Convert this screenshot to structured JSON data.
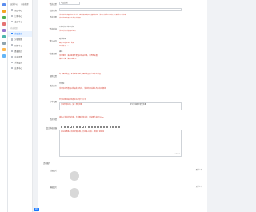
{
  "rail": {
    "colors": [
      "#5b8def",
      "#f5a623",
      "#4caf50",
      "#e57373",
      "#9575cd",
      "#4db6ac",
      "#90a4ae",
      "#ffb74d",
      "#64b5f6"
    ]
  },
  "sidebar": {
    "tabs": [
      "运营中心",
      "内容管理"
    ],
    "group": "内容管理",
    "items": [
      {
        "label": "商品中心",
        "icon": "box-icon",
        "active": false
      },
      {
        "label": "订单中心",
        "icon": "order-icon",
        "active": false
      },
      {
        "label": "会员中心",
        "icon": "user-icon",
        "active": false
      },
      {
        "label": "营销活动",
        "icon": "gift-icon",
        "active": true
      },
      {
        "label": "分销管理",
        "icon": "share-icon",
        "active": false
      },
      {
        "label": "财务中心",
        "icon": "wallet-icon",
        "active": false
      },
      {
        "label": "数据统计",
        "icon": "chart-icon",
        "active": false
      },
      {
        "label": "店铺设置",
        "icon": "shop-icon",
        "active": false
      },
      {
        "label": "系统设置",
        "icon": "gear-icon",
        "active": false
      },
      {
        "label": "应用中心",
        "icon": "app-icon",
        "active": false
      }
    ]
  },
  "form": {
    "type_label": "活动类型",
    "type_value": "单品活动",
    "name_label": "活动名称",
    "desc_label": "活动说明",
    "desc_hint1": "活动名称不超过20个字符，建议填写简短易懂的名称。活动开始前可修改，开始后不可修改",
    "desc_hint2": "活动说明将展示在商品详情页",
    "time_label": "活动时间",
    "time_value": "开始时间 - 结束时间",
    "time_hint": "活动时间不能超过30天",
    "goods_label": "参与商品",
    "goods_value": "选择商品",
    "goods_hint1": "最多可选择50个商品",
    "goods_hint2": "已选商品：0",
    "rule_label": "优惠规则",
    "rule_value": "满减",
    "rule_hint1": "活动规则：满减金额不能超过商品价格，请合理设置",
    "rule_hint2": "满减门槛：满X元减Y元",
    "limit_label": "限购设置",
    "limit_hint": "每人限购数量，不填则不限购；限购数量需小于库存数量",
    "stock_label": "活动库存",
    "stock_value": "不限制",
    "stock_hint": "活动库存不能超过商品实际库存，活动结束后剩余库存自动释放",
    "share_label": "分享设置",
    "share_hint": "分享标题和描述将展示在分享卡片中",
    "share_text": "活动分享标题，如：限时特惠",
    "share_tail": "参与活动即可享受优惠",
    "detail_label": "活动详情",
    "detail_hint": "请输入活动详情内容，支持图片和文字，建议图片宽度750px",
    "toolbar_label": "富文本编辑器",
    "editor_hint": "请在这里输入活动详情内容，支持插入图片、视频、链接等",
    "editor_count": "0/5000",
    "upload_section": "活动图片",
    "cover_label": "封面图片",
    "cover_action": "重新上传",
    "banner_label": "横幅图片",
    "banner_action": "重新上传",
    "submit": "提交"
  }
}
